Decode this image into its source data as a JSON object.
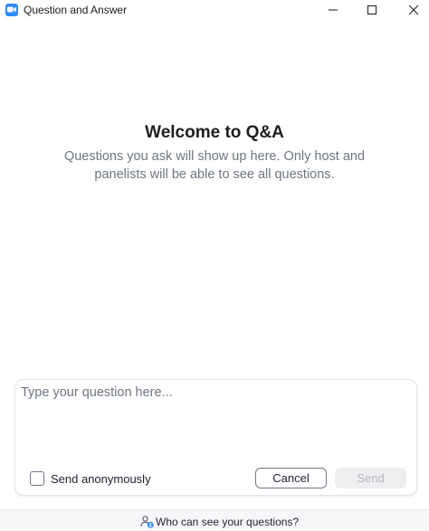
{
  "window": {
    "title": "Question and Answer",
    "icons": {
      "app": "zoom-camera-icon",
      "minimize": "minimize-icon",
      "maximize": "maximize-icon",
      "close": "close-icon"
    }
  },
  "welcome": {
    "title": "Welcome to Q&A",
    "description": "Questions you ask will show up here. Only host and panelists will be able to see all questions."
  },
  "composer": {
    "placeholder": "Type your question here...",
    "value": "",
    "anonymous_label": "Send anonymously",
    "anonymous_checked": false,
    "cancel_label": "Cancel",
    "send_label": "Send",
    "send_enabled": false
  },
  "footer": {
    "link_text": "Who can see your questions?",
    "icon": "people-icon"
  },
  "colors": {
    "accent": "#2D8CFF",
    "text_primary": "#232333",
    "text_muted": "#6e7680",
    "disabled_bg": "#eeeef0",
    "disabled_text": "#b5b5bd"
  }
}
